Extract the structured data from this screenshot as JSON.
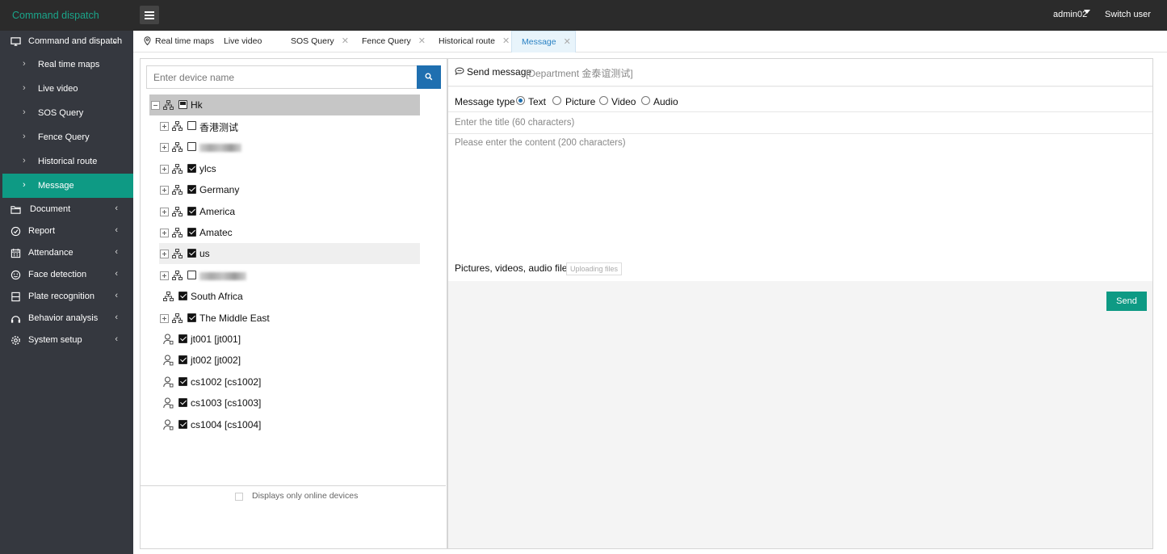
{
  "app": {
    "title": "Command dispatch"
  },
  "header": {
    "user": "admin02",
    "switch_user": "Switch user"
  },
  "sidebar": {
    "sections": [
      {
        "label": "Command and dispatch",
        "icon": "monitor-icon",
        "expanded": true
      },
      {
        "label": "Document",
        "icon": "folder-icon"
      },
      {
        "label": "Report",
        "icon": "gauge-icon"
      },
      {
        "label": "Attendance",
        "icon": "calendar-icon"
      },
      {
        "label": "Face detection",
        "icon": "smile-icon"
      },
      {
        "label": "Plate recognition",
        "icon": "plate-icon"
      },
      {
        "label": "Behavior analysis",
        "icon": "behavior-icon"
      },
      {
        "label": "System setup",
        "icon": "gear-icon"
      }
    ],
    "sub_items": [
      {
        "label": "Real time maps"
      },
      {
        "label": "Live video"
      },
      {
        "label": "SOS Query"
      },
      {
        "label": "Fence Query"
      },
      {
        "label": "Historical route"
      },
      {
        "label": "Message",
        "active": true
      }
    ]
  },
  "tabs": [
    {
      "label": "Real time maps",
      "icon": "map-pin-icon",
      "closable": false
    },
    {
      "label": "Live video",
      "closable": false
    },
    {
      "label": "SOS Query",
      "closable": true
    },
    {
      "label": "Fence Query",
      "closable": true
    },
    {
      "label": "Historical route",
      "closable": true
    },
    {
      "label": "Message",
      "closable": true,
      "active": true
    }
  ],
  "device_panel": {
    "search_placeholder": "Enter device name",
    "tree": {
      "root": {
        "label": "Hk",
        "state": "partial"
      },
      "children": [
        {
          "label": "香港测试",
          "checked": false,
          "type": "group"
        },
        {
          "label": "",
          "checked": false,
          "type": "group",
          "obscured": true
        },
        {
          "label": "ylcs",
          "checked": true,
          "type": "group"
        },
        {
          "label": "Germany",
          "checked": true,
          "type": "group"
        },
        {
          "label": "America",
          "checked": true,
          "type": "group"
        },
        {
          "label": "Amatec",
          "checked": true,
          "type": "group"
        },
        {
          "label": "us",
          "checked": true,
          "type": "group",
          "highlighted": true
        },
        {
          "label": "",
          "checked": false,
          "type": "group",
          "obscured": true
        },
        {
          "label": "South Africa",
          "checked": true,
          "type": "group-leaf"
        },
        {
          "label": "The Middle East",
          "checked": true,
          "type": "group"
        },
        {
          "label": "jt001 [jt001]",
          "checked": true,
          "type": "user"
        },
        {
          "label": "jt002 [jt002]",
          "checked": true,
          "type": "user"
        },
        {
          "label": "cs1002 [cs1002]",
          "checked": true,
          "type": "user"
        },
        {
          "label": "cs1003 [cs1003]",
          "checked": true,
          "type": "user"
        },
        {
          "label": "cs1004 [cs1004]",
          "checked": true,
          "type": "user"
        }
      ]
    },
    "online_only_label": "Displays only online devices"
  },
  "message_panel": {
    "title": "Send message",
    "department": "[Department 金泰谊测试]",
    "type_label": "Message type",
    "types": [
      {
        "label": "Text",
        "selected": true
      },
      {
        "label": "Picture",
        "selected": false
      },
      {
        "label": "Video",
        "selected": false
      },
      {
        "label": "Audio",
        "selected": false
      }
    ],
    "title_placeholder": "Enter the title (60 characters)",
    "content_placeholder": "Please enter the content (200 characters)",
    "files_label": "Pictures, videos, audio files",
    "upload_label": "Uploading files",
    "send_label": "Send"
  },
  "colors": {
    "accent": "#0e9a84",
    "brand": "#1aa58a",
    "primary": "#1f6fb0",
    "sidebar": "#35383f",
    "topbar": "#2b2b2b"
  }
}
